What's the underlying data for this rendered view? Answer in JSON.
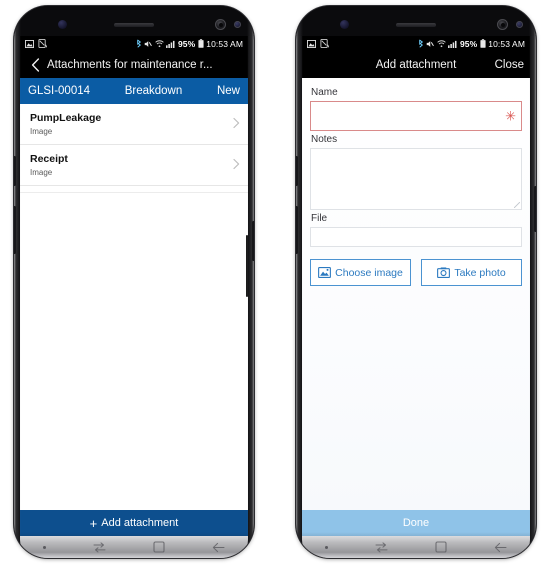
{
  "status_bar": {
    "icons_left": [
      "image-icon",
      "no-sim-card-icon"
    ],
    "icons_right": [
      "bluetooth-icon",
      "mute-icon",
      "wifi-icon",
      "signal-bars-icon"
    ],
    "battery_percent": "95%",
    "battery_icon": "battery-icon",
    "time": "10:53 AM"
  },
  "colors": {
    "record_bar_blue": "#0b5ca4",
    "action_bar_blue": "#0d4f8e",
    "done_bar_blue": "#8fc3e8",
    "button_blue": "#2c7ac0",
    "required_red": "#d9534f"
  },
  "left_phone": {
    "appbar": {
      "back_icon": "chevron-left-icon",
      "title": "Attachments for maintenance r..."
    },
    "record_bar": {
      "id": "GLSI-00014",
      "type": "Breakdown",
      "status": "New"
    },
    "list": [
      {
        "title": "PumpLeakage",
        "subtitle": "Image",
        "chevron": "chevron-right-icon"
      },
      {
        "title": "Receipt",
        "subtitle": "Image",
        "chevron": "chevron-right-icon"
      }
    ],
    "action_bar": {
      "plus_icon": "plus-icon",
      "label": "Add attachment"
    },
    "nav_bar": [
      "dot-icon",
      "recents-icon",
      "home-icon",
      "back-arrow-icon"
    ]
  },
  "right_phone": {
    "appbar": {
      "title": "Add attachment",
      "close_label": "Close"
    },
    "form": {
      "name": {
        "label": "Name",
        "value": "",
        "placeholder": "",
        "required_marker": "✳"
      },
      "notes": {
        "label": "Notes",
        "value": "",
        "placeholder": ""
      },
      "file": {
        "label": "File",
        "value": "",
        "placeholder": ""
      },
      "choose_image_button": {
        "label": "Choose image",
        "icon": "picture-icon"
      },
      "take_photo_button": {
        "label": "Take photo",
        "icon": "camera-icon"
      }
    },
    "action_bar": {
      "label": "Done"
    },
    "nav_bar": [
      "dot-icon",
      "recents-icon",
      "home-icon",
      "back-arrow-icon"
    ]
  }
}
